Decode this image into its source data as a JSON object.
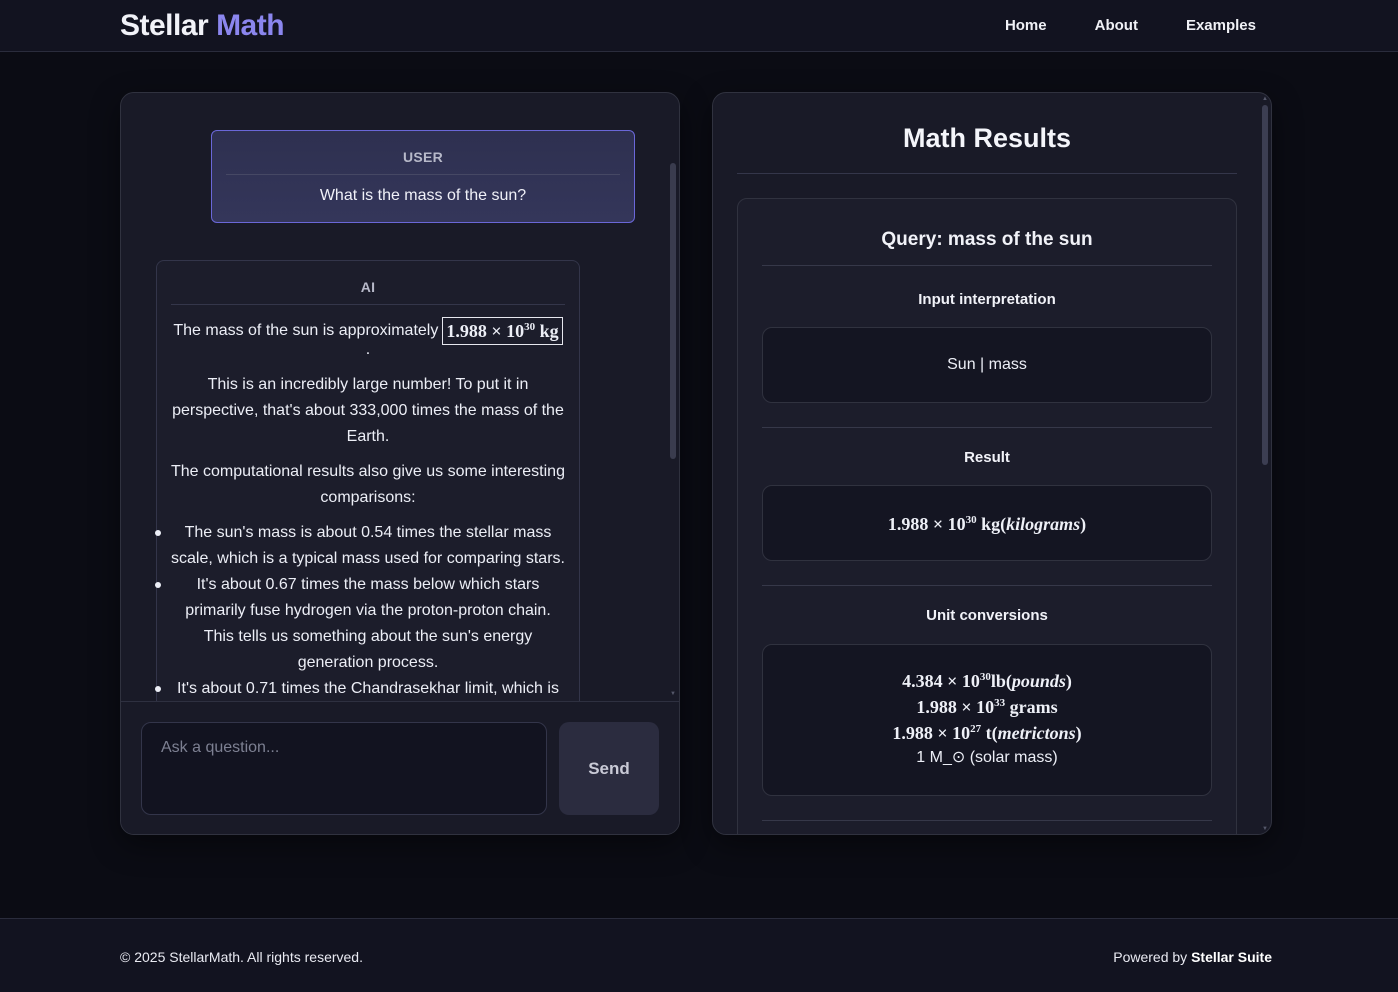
{
  "header": {
    "brand_part1": "Stellar",
    "brand_part2": "Math",
    "nav": [
      "Home",
      "About",
      "Examples"
    ]
  },
  "chat": {
    "user_message": {
      "role": "USER",
      "text": "What is the mass of the sun?"
    },
    "ai_message": {
      "role": "AI",
      "intro": "The mass of the sun is approximately",
      "boxed_value_mantissa": "1.988 × 10",
      "boxed_value_exponent": "30",
      "boxed_value_unit": "kg",
      "trailing": ".",
      "paragraph1": "This is an incredibly large number! To put it in perspective, that's about 333,000 times the mass of the Earth.",
      "paragraph2": "The computational results also give us some interesting comparisons:",
      "bullets": [
        "The sun's mass is about 0.54 times the stellar mass scale, which is a typical mass used for comparing stars.",
        "It's about 0.67 times the mass below which stars primarily fuse hydrogen via the proton-proton chain. This tells us something about the sun's energy generation process.",
        "It's about 0.71 times the Chandrasekhar limit, which is"
      ]
    },
    "input": {
      "placeholder": "Ask a question...",
      "value": ""
    },
    "send_label": "Send"
  },
  "results": {
    "title": "Math Results",
    "query_title": "Query: mass of the sun",
    "pods": {
      "input_interpretation": {
        "title": "Input interpretation",
        "value": "Sun | mass"
      },
      "result": {
        "title": "Result",
        "mantissa": "1.988 × 10",
        "exponent": "30",
        "unit": "kg",
        "unit_name": "kilograms"
      },
      "unit_conversions": {
        "title": "Unit conversions",
        "lines": [
          {
            "mantissa": "4.384 × 10",
            "exponent": "30",
            "unit": "lb",
            "unit_name": "pounds"
          },
          {
            "mantissa": "1.988 × 10",
            "exponent": "33",
            "unit": "grams",
            "unit_name": ""
          },
          {
            "mantissa": "1.988 × 10",
            "exponent": "27",
            "unit": "t",
            "unit_name": "metrictons"
          }
        ],
        "plain_line": "1 M_⊙ (solar mass)"
      }
    }
  },
  "footer": {
    "copyright": "© 2025 StellarMath. All rights reserved.",
    "powered_prefix": "Powered by",
    "powered_brand": "Stellar Suite"
  }
}
